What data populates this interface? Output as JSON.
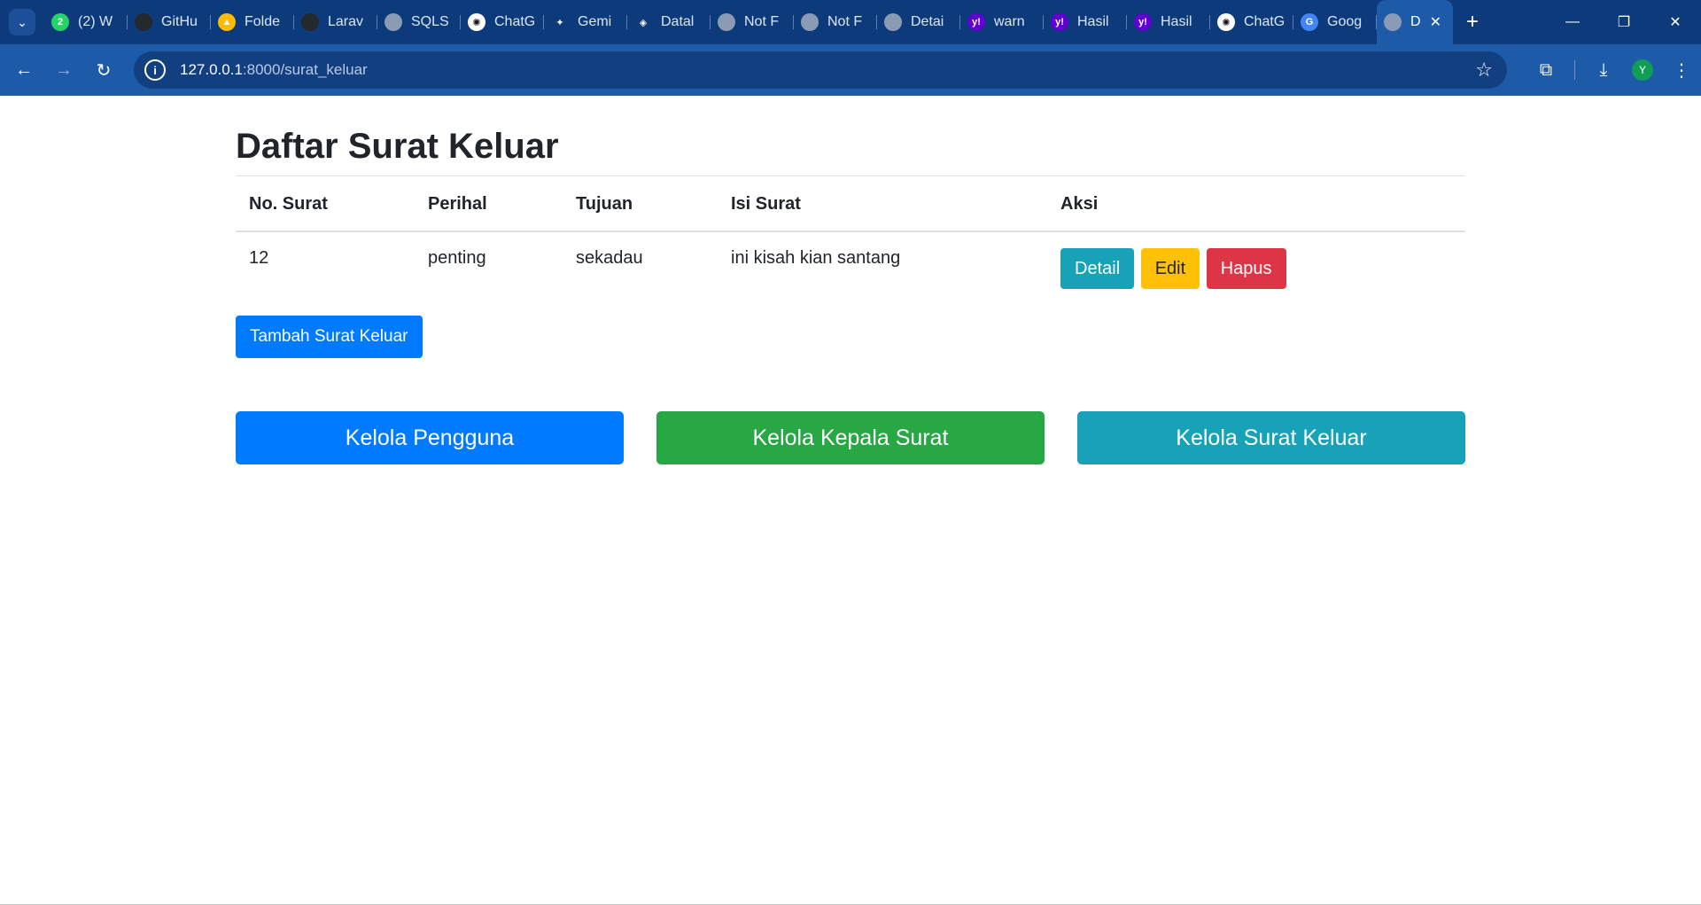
{
  "browser": {
    "tabs": [
      {
        "label": "(2) W",
        "icon": "whatsapp-icon",
        "fav_color": "#25d366",
        "fav_text": "2"
      },
      {
        "label": "GitHu",
        "icon": "github-icon",
        "fav_color": "#24292e",
        "fav_text": ""
      },
      {
        "label": "Folde",
        "icon": "google-drive-icon",
        "fav_color": "#fbbc04",
        "fav_text": "▲"
      },
      {
        "label": "Larav",
        "icon": "github-icon",
        "fav_color": "#24292e",
        "fav_text": ""
      },
      {
        "label": "SQLS",
        "icon": "globe-icon",
        "fav_color": "#8a9bb5",
        "fav_text": ""
      },
      {
        "label": "ChatG",
        "icon": "chatgpt-icon",
        "fav_color": "#ffffff",
        "fav_text": "✺"
      },
      {
        "label": "Gemi",
        "icon": "gemini-icon",
        "fav_color": "#0d3a7a",
        "fav_text": "✦"
      },
      {
        "label": "Datal",
        "icon": "laravel-icon",
        "fav_color": "#0d3a7a",
        "fav_text": "◈"
      },
      {
        "label": "Not F",
        "icon": "globe-icon",
        "fav_color": "#8a9bb5",
        "fav_text": ""
      },
      {
        "label": "Not F",
        "icon": "globe-icon",
        "fav_color": "#8a9bb5",
        "fav_text": ""
      },
      {
        "label": "Detai",
        "icon": "globe-icon",
        "fav_color": "#8a9bb5",
        "fav_text": ""
      },
      {
        "label": "warn",
        "icon": "yahoo-icon",
        "fav_color": "#6001d2",
        "fav_text": "y!"
      },
      {
        "label": "Hasil",
        "icon": "yahoo-icon",
        "fav_color": "#6001d2",
        "fav_text": "y!"
      },
      {
        "label": "Hasil",
        "icon": "yahoo-icon",
        "fav_color": "#6001d2",
        "fav_text": "y!"
      },
      {
        "label": "ChatG",
        "icon": "chatgpt-icon",
        "fav_color": "#ffffff",
        "fav_text": "✺"
      },
      {
        "label": "Goog",
        "icon": "google-translate-icon",
        "fav_color": "#4285f4",
        "fav_text": "G"
      }
    ],
    "active_tab": {
      "label": "D",
      "icon": "globe-icon"
    },
    "url_host": "127.0.0.1",
    "url_path": ":8000/surat_keluar",
    "avatar_letter": "Y"
  },
  "page": {
    "title": "Daftar Surat Keluar",
    "table": {
      "headers": [
        "No. Surat",
        "Perihal",
        "Tujuan",
        "Isi Surat",
        "Aksi"
      ],
      "rows": [
        {
          "no": "12",
          "perihal": "penting",
          "tujuan": "sekadau",
          "isi": "ini kisah kian santang"
        }
      ],
      "actions": {
        "detail": "Detail",
        "edit": "Edit",
        "hapus": "Hapus"
      }
    },
    "add_button": "Tambah Surat Keluar",
    "nav_buttons": {
      "pengguna": "Kelola Pengguna",
      "kepala": "Kelola Kepala Surat",
      "keluar": "Kelola Surat Keluar"
    }
  },
  "colors": {
    "primary": "#007bff",
    "success": "#28a745",
    "info": "#17a2b8",
    "warning": "#ffc107",
    "danger": "#dc3545"
  }
}
